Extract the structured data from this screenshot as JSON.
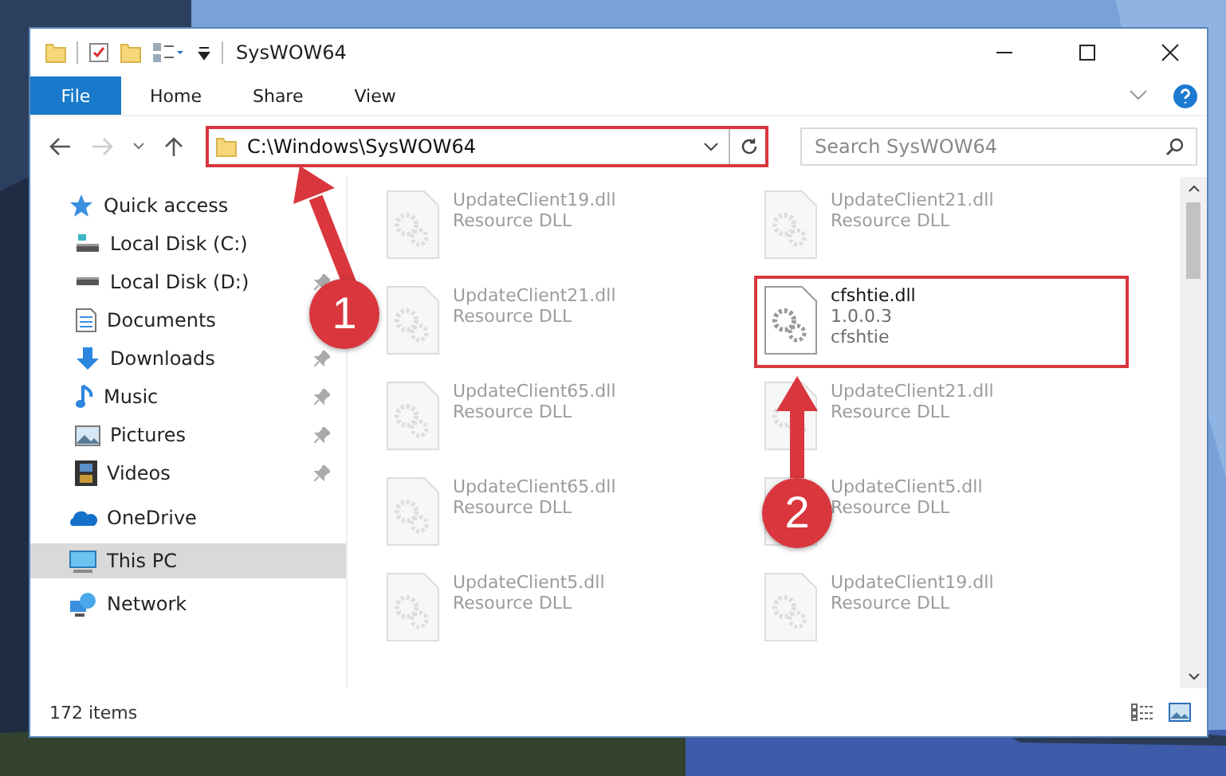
{
  "window": {
    "title": "SysWOW64"
  },
  "ribbon_tabs": [
    {
      "label": "File",
      "kind": "file"
    },
    {
      "label": "Home",
      "kind": "tab"
    },
    {
      "label": "Share",
      "kind": "tab"
    },
    {
      "label": "View",
      "kind": "tab"
    }
  ],
  "address": {
    "path": "C:\\Windows\\SysWOW64",
    "highlighted": true
  },
  "search": {
    "placeholder": "Search SysWOW64"
  },
  "sidebar": {
    "items": [
      {
        "label": "Quick access",
        "kind": "star",
        "selected": false,
        "children": [
          {
            "label": "Local Disk (C:)",
            "kind": "drive",
            "pinned": false
          },
          {
            "label": "Local Disk (D:)",
            "kind": "drive",
            "pinned": true
          },
          {
            "label": "Documents",
            "kind": "documents",
            "pinned": false
          },
          {
            "label": "Downloads",
            "kind": "downloads",
            "pinned": true
          },
          {
            "label": "Music",
            "kind": "music",
            "pinned": true
          },
          {
            "label": "Pictures",
            "kind": "pictures",
            "pinned": true
          },
          {
            "label": "Videos",
            "kind": "videos",
            "pinned": true
          }
        ]
      },
      {
        "label": "OneDrive",
        "kind": "cloud",
        "selected": false
      },
      {
        "label": "This PC",
        "kind": "pc",
        "selected": true
      },
      {
        "label": "Network",
        "kind": "network",
        "selected": false
      }
    ]
  },
  "files": [
    {
      "name": "UpdateClient19.dll",
      "detail_1": "Resource DLL",
      "faded": true,
      "highlighted": false
    },
    {
      "name": "UpdateClient21.dll",
      "detail_1": "Resource DLL",
      "faded": true,
      "highlighted": false
    },
    {
      "name": "UpdateClient21.dll",
      "detail_1": "Resource DLL",
      "faded": true,
      "highlighted": false
    },
    {
      "name": "cfshtie.dll",
      "detail_1": "1.0.0.3",
      "detail_2": "cfshtie",
      "faded": false,
      "highlighted": true
    },
    {
      "name": "UpdateClient65.dll",
      "detail_1": "Resource DLL",
      "faded": true,
      "highlighted": false
    },
    {
      "name": "UpdateClient21.dll",
      "detail_1": "Resource DLL",
      "faded": true,
      "highlighted": false
    },
    {
      "name": "UpdateClient65.dll",
      "detail_1": "Resource DLL",
      "faded": true,
      "highlighted": false
    },
    {
      "name": "UpdateClient5.dll",
      "detail_1": "Resource DLL",
      "faded": true,
      "highlighted": false
    },
    {
      "name": "UpdateClient5.dll",
      "detail_1": "Resource DLL",
      "faded": true,
      "highlighted": false
    },
    {
      "name": "UpdateClient19.dll",
      "detail_1": "Resource DLL",
      "faded": true,
      "highlighted": false
    }
  ],
  "status_bar": {
    "item_count": "172 items"
  },
  "annotations": [
    {
      "number": "1"
    },
    {
      "number": "2"
    }
  ]
}
